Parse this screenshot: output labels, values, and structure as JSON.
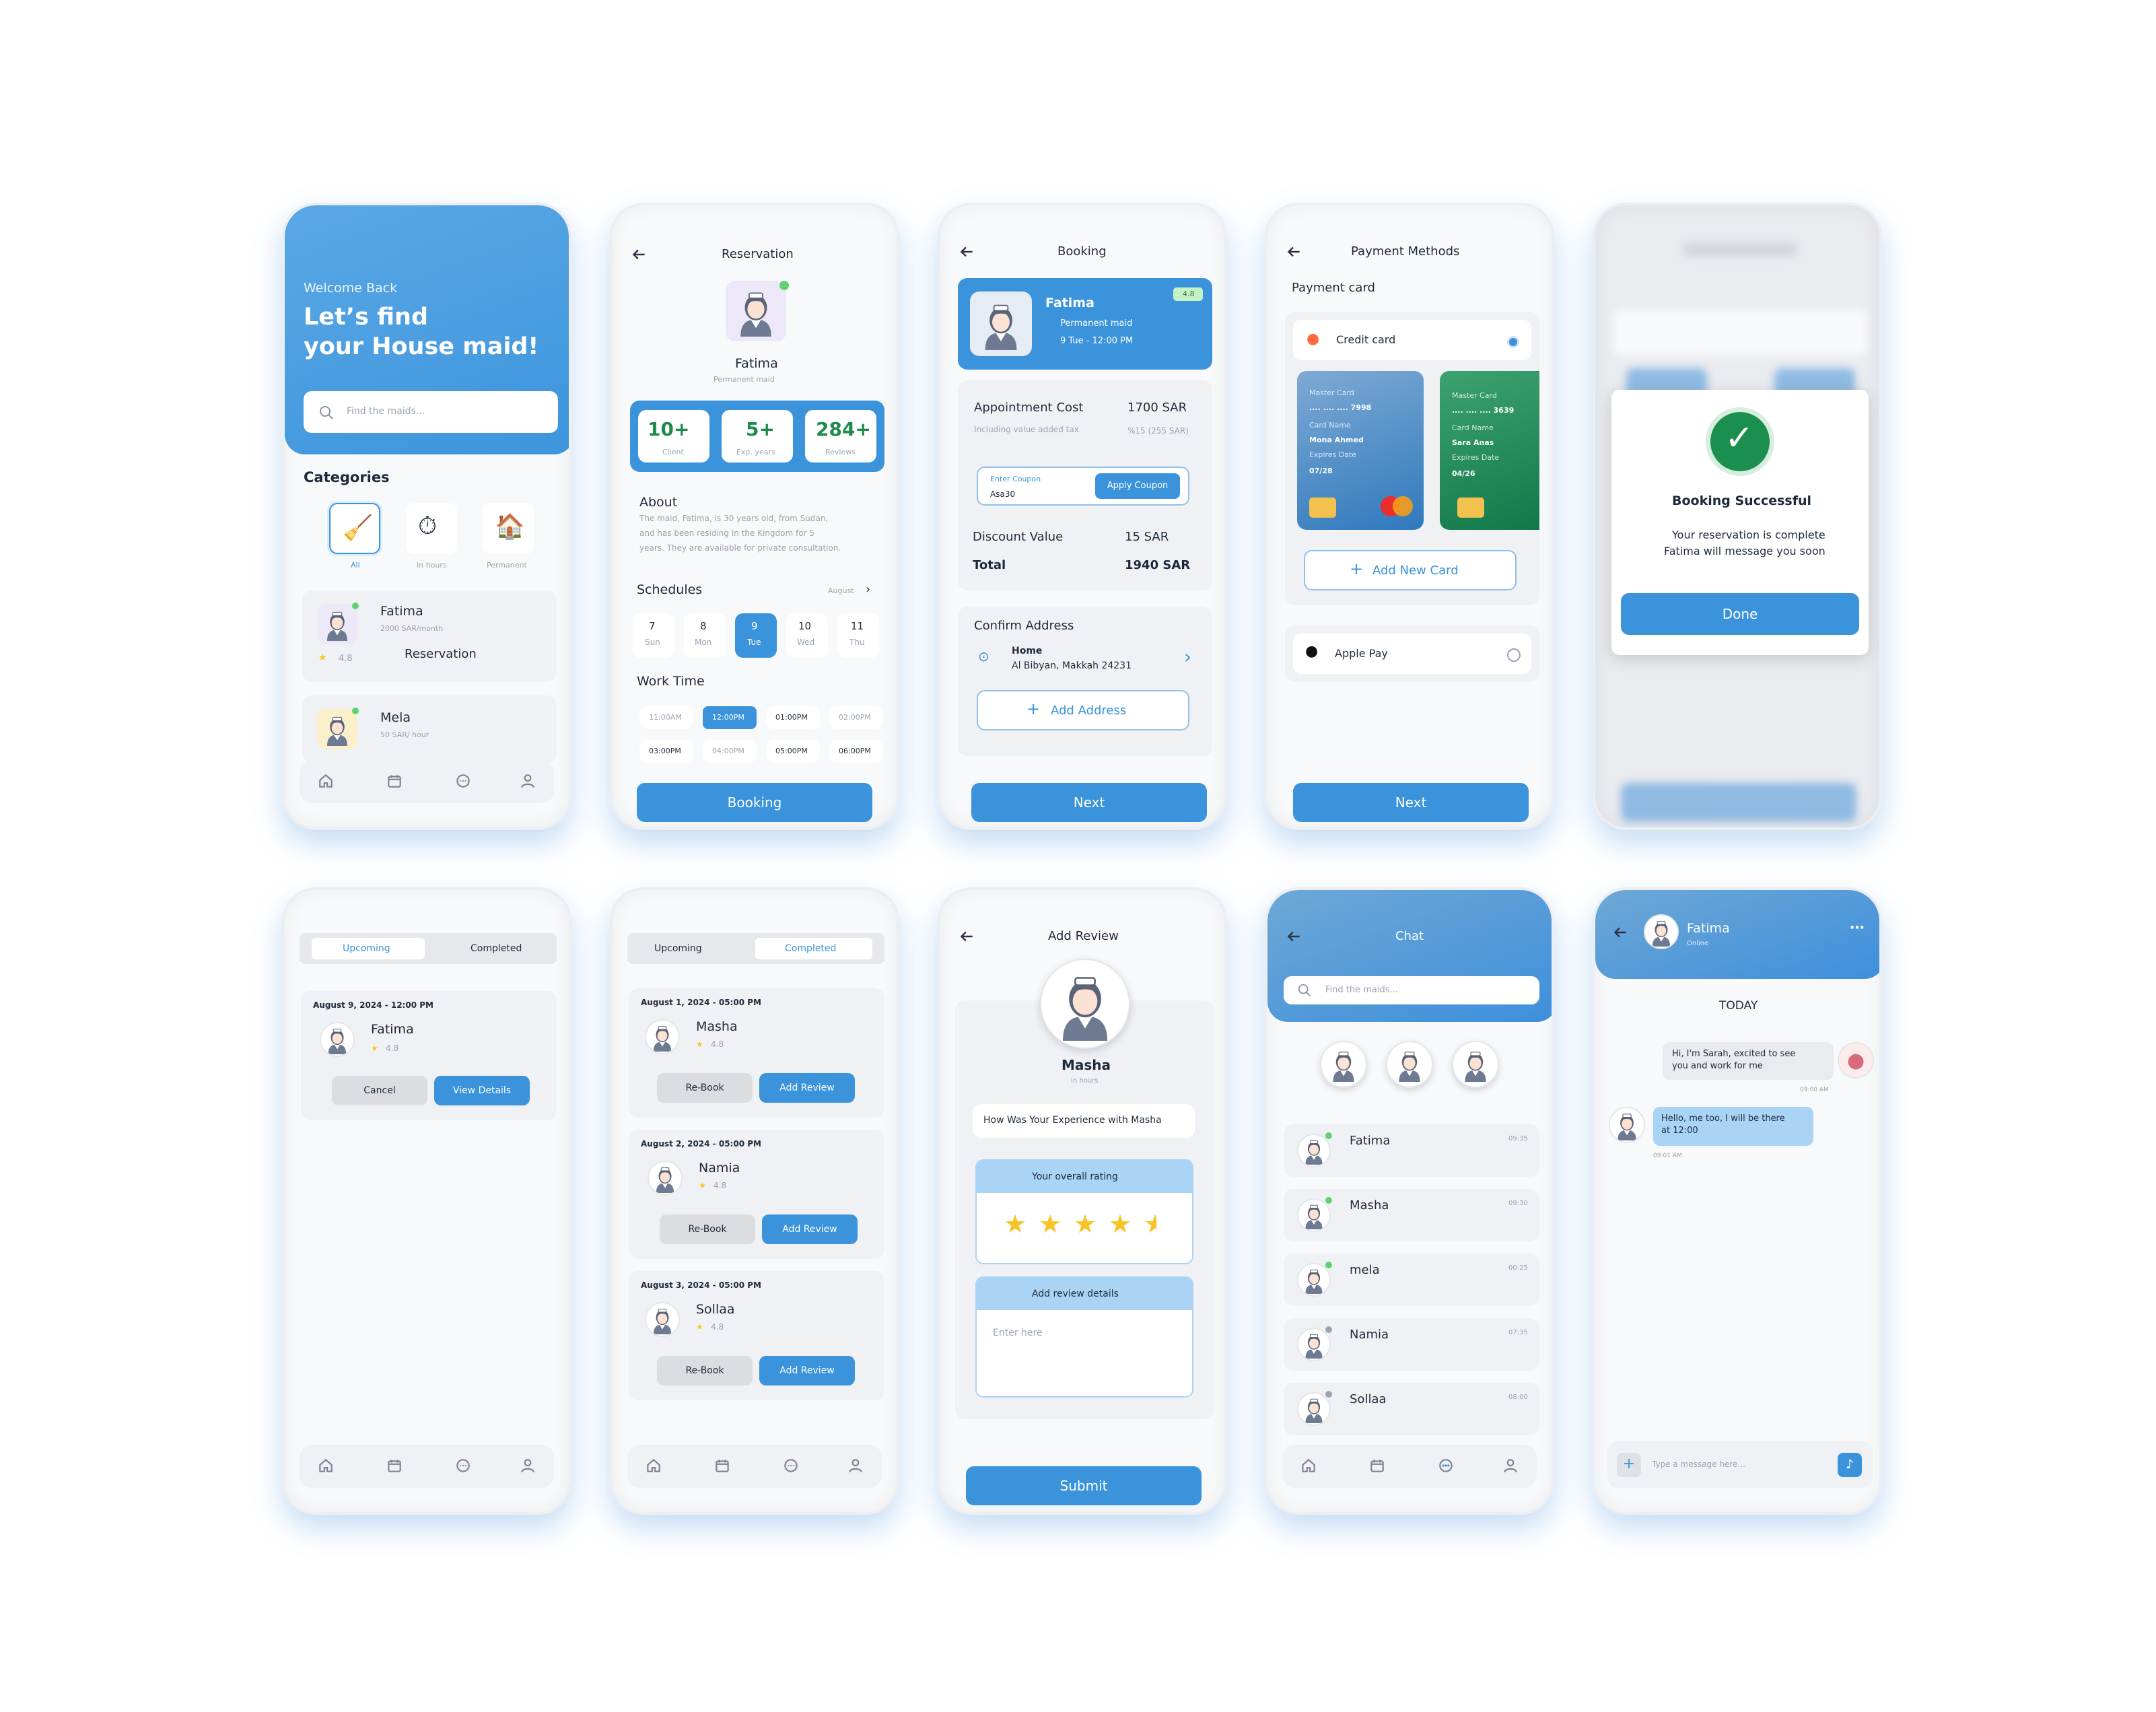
{
  "home": {
    "welcome": "Welcome Back",
    "headline1": "Let’s find",
    "headline2": "your House maid!",
    "search_placeholder": "Find the maids...",
    "categories_title": "Categories",
    "categories": [
      {
        "label": "All"
      },
      {
        "label": "In hours"
      },
      {
        "label": "Permanent"
      }
    ],
    "maids": [
      {
        "name": "Fatima",
        "price": "2000 SAR/month",
        "rating": "4.8",
        "action": "Reservation"
      },
      {
        "name": "Mela",
        "price": "50 SAR/ hour"
      }
    ]
  },
  "reservation": {
    "title": "Reservation",
    "name": "Fatima",
    "type": "Permanent maid",
    "stats": [
      {
        "value": "10+",
        "label": "Client"
      },
      {
        "value": "5+",
        "label": "Exp. years"
      },
      {
        "value": "284+",
        "label": "Reviews"
      }
    ],
    "about_title": "About",
    "about_text": [
      "The maid, Fatima, is 30 years old, from Sudan,",
      "and has been residing in the Kingdom for 5",
      "years. They are available for private consultation."
    ],
    "schedules_title": "Schedules",
    "month": "August",
    "days": [
      {
        "num": "7",
        "day": "Sun"
      },
      {
        "num": "8",
        "day": "Mon"
      },
      {
        "num": "9",
        "day": "Tue"
      },
      {
        "num": "10",
        "day": "Wed"
      },
      {
        "num": "11",
        "day": "Thu"
      }
    ],
    "work_time_title": "Work Time",
    "times": [
      "11:00AM",
      "12:00PM",
      "01:00PM",
      "02:00PM",
      "03:00PM",
      "04:00PM",
      "05:00PM",
      "06:00PM"
    ],
    "button": "Booking"
  },
  "booking": {
    "title": "Booking",
    "name": "Fatima",
    "type": "Permanent maid",
    "date": "9 Tue - 12:00 PM",
    "rating": "4.8",
    "appointment_label": "Appointment Cost",
    "appointment_value": "1700 SAR",
    "vat_label": "Including value added tax",
    "vat_value": "%15 (255 SAR)",
    "coupon_label": "Enter Coupon",
    "coupon_value": "Asa30",
    "coupon_button": "Apply Coupon",
    "discount_label": "Discount Value",
    "discount_value": "15 SAR",
    "total_label": "Total",
    "total_value": "1940 SAR",
    "address_title": "Confirm Address",
    "address_name": "Home",
    "address_line": "Al Bibyan, Makkah 24231",
    "add_address": "Add Address",
    "button": "Next"
  },
  "payment": {
    "title": "Payment Methods",
    "section": "Payment card",
    "credit_card": "Credit card",
    "cards": [
      {
        "brand": "Master Card",
        "number": ".... .... .... 7998",
        "name_label": "Card Name",
        "name": "Mona Ahmed",
        "exp_label": "Expires Date",
        "exp": "07/28",
        "color": "#3f88c5"
      },
      {
        "brand": "Master Card",
        "number": ".... .... .... 3639",
        "name_label": "Card Name",
        "name": "Sara Anas",
        "exp_label": "Expires Date",
        "exp": "04/26",
        "color": "#1f8a5b"
      }
    ],
    "add_card": "Add New Card",
    "apple_pay": "Apple Pay",
    "button": "Next"
  },
  "success": {
    "title": "Booking Successful",
    "line1": "Your reservation is complete",
    "line2": "Fatima will message you soon",
    "button": "Done"
  },
  "upcoming": {
    "tabs": [
      "Upcoming",
      "Completed"
    ],
    "date": "August 9, 2024 - 12:00 PM",
    "name": "Fatima",
    "rating": "4.8",
    "cancel": "Cancel",
    "details": "View Details"
  },
  "completed": {
    "tabs": [
      "Upcoming",
      "Completed"
    ],
    "items": [
      {
        "date": "August 1, 2024 - 05:00 PM",
        "name": "Masha",
        "rating": "4.8"
      },
      {
        "date": "August 2, 2024 - 05:00 PM",
        "name": "Namia",
        "rating": "4.8"
      },
      {
        "date": "August 3, 2024 - 05:00 PM",
        "name": "Sollaa",
        "rating": "4.8"
      }
    ],
    "rebook": "Re-Book",
    "review": "Add Review"
  },
  "review": {
    "title": "Add Review",
    "name": "Masha",
    "type": "In hours",
    "question": "How Was Your Experience with Masha",
    "rating_title": "Your overall rating",
    "rating": 4.5,
    "details_title": "Add review details",
    "placeholder": "Enter here",
    "button": "Submit"
  },
  "chat": {
    "title": "Chat",
    "search_placeholder": "Find the maids...",
    "items": [
      {
        "name": "Fatima",
        "time": "09:35"
      },
      {
        "name": "Masha",
        "time": "09:30"
      },
      {
        "name": "mela",
        "time": "00:25"
      },
      {
        "name": "Namia",
        "time": "07:35"
      },
      {
        "name": "Sollaa",
        "time": "08:00"
      }
    ]
  },
  "conversation": {
    "name": "Fatima",
    "status": "Online",
    "day": "TODAY",
    "msg1": [
      "Hi, I'm Sarah, excited to see",
      "you and work for me"
    ],
    "time1": "09:00 AM",
    "msg2": [
      "Hello, me too, I will be there",
      "at 12:00"
    ],
    "time2": "09:01 AM",
    "placeholder": "Type a message here..."
  },
  "colors": {
    "primary": "#3a93db",
    "header": "#4f9fe2",
    "card_green": "#1f8a5b",
    "card_blue": "#3f88c5"
  }
}
